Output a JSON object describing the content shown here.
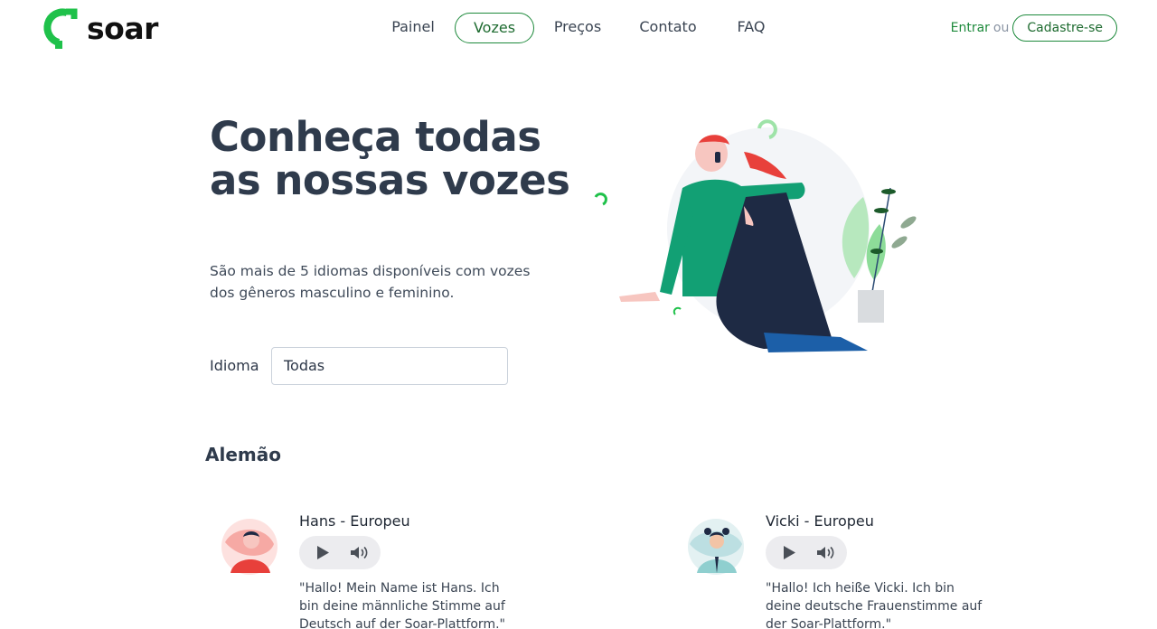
{
  "brand": {
    "name": "soar",
    "accent": "#1fc14a"
  },
  "nav": {
    "items": [
      {
        "label": "Painel",
        "active": false
      },
      {
        "label": "Vozes",
        "active": true
      },
      {
        "label": "Preços",
        "active": false
      },
      {
        "label": "Contato",
        "active": false
      },
      {
        "label": "FAQ",
        "active": false
      }
    ]
  },
  "auth": {
    "login": "Entrar",
    "or": "ou",
    "signup": "Cadastre-se"
  },
  "hero": {
    "title": "Conheça todas as nossas vozes",
    "subtitle": "São mais de 5 idiomas disponíveis com vozes dos gêneros masculino e feminino."
  },
  "filter": {
    "label": "Idioma",
    "value": "Todas"
  },
  "section": {
    "title": "Alemão"
  },
  "voices": [
    {
      "name": "Hans - Europeu",
      "description": "\"Hallo! Mein Name ist Hans. Ich bin deine männliche Stimme auf Deutsch auf der Soar-Plattform.\"",
      "icons": [
        "play-icon",
        "volume-icon"
      ]
    },
    {
      "name": "Vicki - Europeu",
      "description": "\"Hallo! Ich heiße Vicki. Ich bin deine deutsche Frauenstimme auf der Soar-Plattform.\"",
      "icons": [
        "play-icon",
        "volume-icon"
      ]
    }
  ]
}
